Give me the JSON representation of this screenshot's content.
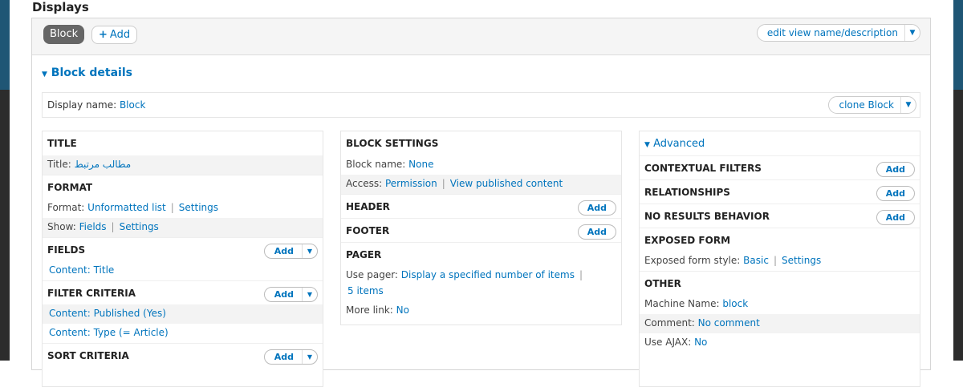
{
  "displays": {
    "title": "Displays",
    "tab_block": "Block",
    "tab_add": "Add",
    "edit_view_label": "edit view name/description"
  },
  "block_details": {
    "heading": "Block details",
    "display_name_label": "Display name:",
    "display_name_value": "Block",
    "clone_label": "clone Block"
  },
  "col1": {
    "title_head": "TITLE",
    "title_label": "Title:",
    "title_value": "مطالب مرتبط",
    "format_head": "FORMAT",
    "format_label": "Format:",
    "format_value": "Unformatted list",
    "format_settings": "Settings",
    "show_label": "Show:",
    "show_value": "Fields",
    "show_settings": "Settings",
    "fields_head": "FIELDS",
    "fields_add": "Add",
    "fields_item": "Content: Title",
    "filter_head": "FILTER CRITERIA",
    "filter_add": "Add",
    "filter_item1": "Content: Published (Yes)",
    "filter_item2": "Content: Type (= Article)",
    "sort_head": "SORT CRITERIA",
    "sort_add": "Add"
  },
  "col2": {
    "block_settings_head": "BLOCK SETTINGS",
    "block_name_label": "Block name:",
    "block_name_value": "None",
    "access_label": "Access:",
    "access_value": "Permission",
    "access_perm": "View published content",
    "header_head": "HEADER",
    "header_add": "Add",
    "footer_head": "FOOTER",
    "footer_add": "Add",
    "pager_head": "PAGER",
    "use_pager_label": "Use pager:",
    "use_pager_value": "Display a specified number of items",
    "pager_items": "5 items",
    "more_link_label": "More link:",
    "more_link_value": "No"
  },
  "col3": {
    "advanced_label": "Advanced",
    "contextual_head": "CONTEXTUAL FILTERS",
    "contextual_add": "Add",
    "relationships_head": "RELATIONSHIPS",
    "relationships_add": "Add",
    "no_results_head": "NO RESULTS BEHAVIOR",
    "no_results_add": "Add",
    "exposed_head": "EXPOSED FORM",
    "exposed_label": "Exposed form style:",
    "exposed_value": "Basic",
    "exposed_settings": "Settings",
    "other_head": "OTHER",
    "machine_label": "Machine Name:",
    "machine_value": "block",
    "comment_label": "Comment:",
    "comment_value": "No comment",
    "ajax_label": "Use AJAX:",
    "ajax_value": "No"
  }
}
